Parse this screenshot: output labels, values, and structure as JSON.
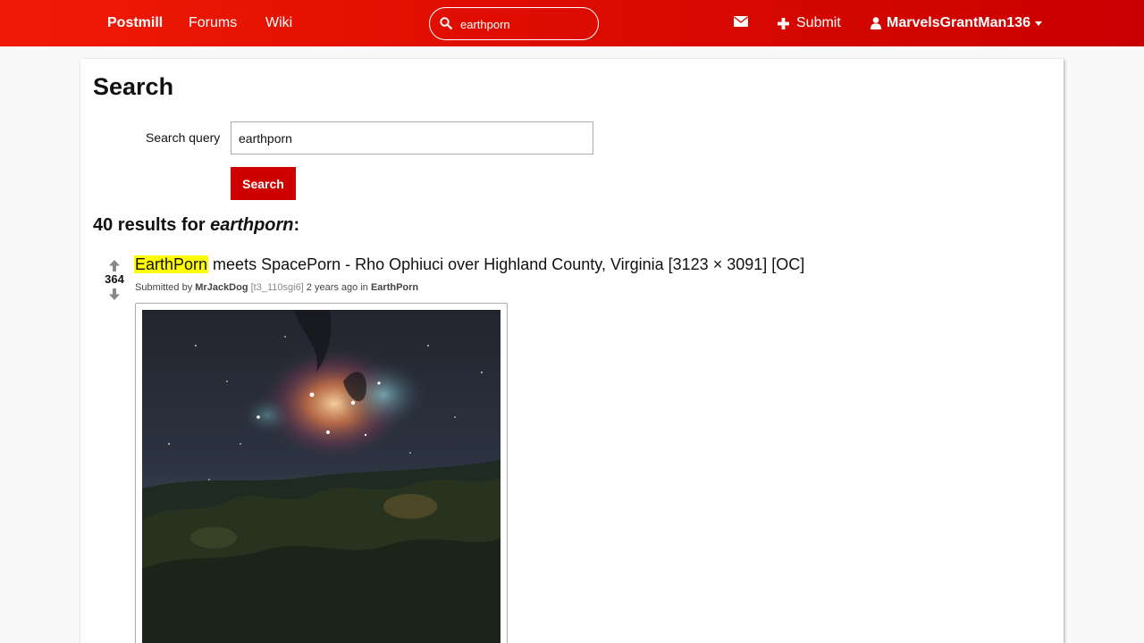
{
  "nav": {
    "brand": "Postmill",
    "forums": "Forums",
    "wiki": "Wiki",
    "search_value": "earthporn",
    "submit": "Submit",
    "username": "MarvelsGrantMan136"
  },
  "search": {
    "title": "Search",
    "query_label": "Search query",
    "query_value": "earthporn",
    "button": "Search"
  },
  "results": {
    "count_prefix": "40 results for ",
    "query": "earthporn",
    "count_suffix": ":"
  },
  "submission": {
    "score": "364",
    "title_highlight": "EarthPorn",
    "title_rest": " meets SpacePorn - Rho Ophiuci over Highland County, Virginia [3123 × 3091] [OC]",
    "submitted_by": "Submitted by ",
    "author": "MrJackDog",
    "id_tag": "[t3_110sgi6]",
    "age": " 2 years ago in ",
    "forum": "EarthPorn"
  },
  "icons": {
    "search": "search-icon",
    "mail": "envelope-icon",
    "submit": "plus-icon",
    "user": "user-icon",
    "dropdown": "caret-down-icon",
    "upvote": "arrow-up-icon",
    "downvote": "arrow-down-icon"
  },
  "colors": {
    "nav_start": "#f01a06",
    "nav_end": "#c90000",
    "button": "#cf0000",
    "highlight": "#ffff00"
  }
}
